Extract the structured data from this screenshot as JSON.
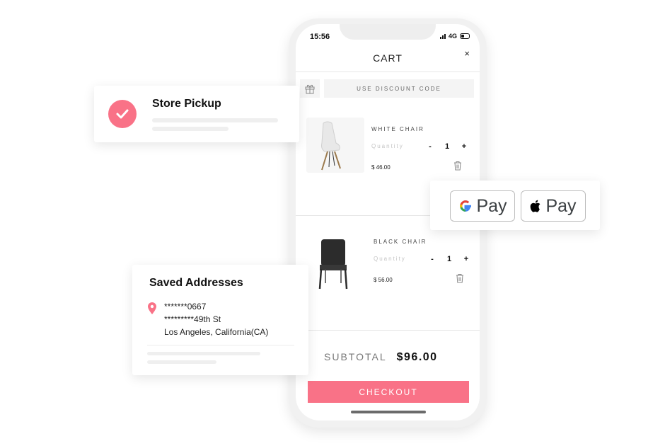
{
  "status_bar": {
    "time": "15:56",
    "network": "4G"
  },
  "cart": {
    "title": "CART",
    "close_icon": "×",
    "discount_label": "USE DISCOUNT CODE",
    "items": [
      {
        "name": "WHITE CHAIR",
        "quantity_label": "Quantity",
        "minus": "-",
        "quantity": "1",
        "plus": "+",
        "price": "$ 46.00"
      },
      {
        "name": "BLACK CHAIR",
        "quantity_label": "Quantity",
        "minus": "-",
        "quantity": "1",
        "plus": "+",
        "price": "$ 56.00"
      }
    ],
    "subtotal_label": "SUBTOTAL",
    "subtotal_value": "$96.00",
    "checkout_label": "CHECKOUT"
  },
  "store_pickup": {
    "title": "Store Pickup"
  },
  "saved_addresses": {
    "title": "Saved Addresses",
    "lines": [
      "*******0667",
      "*********49th St",
      "Los Angeles, California(CA)"
    ]
  },
  "payments": {
    "google_pay": "Pay",
    "apple_pay": "Pay"
  },
  "colors": {
    "accent": "#f97287"
  }
}
